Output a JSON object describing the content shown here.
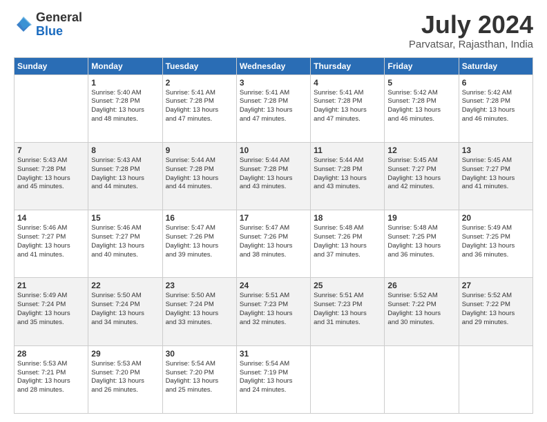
{
  "logo": {
    "general": "General",
    "blue": "Blue"
  },
  "header": {
    "month": "July 2024",
    "location": "Parvatsar, Rajasthan, India"
  },
  "weekdays": [
    "Sunday",
    "Monday",
    "Tuesday",
    "Wednesday",
    "Thursday",
    "Friday",
    "Saturday"
  ],
  "weeks": [
    [
      {
        "day": "",
        "info": ""
      },
      {
        "day": "1",
        "info": "Sunrise: 5:40 AM\nSunset: 7:28 PM\nDaylight: 13 hours\nand 48 minutes."
      },
      {
        "day": "2",
        "info": "Sunrise: 5:41 AM\nSunset: 7:28 PM\nDaylight: 13 hours\nand 47 minutes."
      },
      {
        "day": "3",
        "info": "Sunrise: 5:41 AM\nSunset: 7:28 PM\nDaylight: 13 hours\nand 47 minutes."
      },
      {
        "day": "4",
        "info": "Sunrise: 5:41 AM\nSunset: 7:28 PM\nDaylight: 13 hours\nand 47 minutes."
      },
      {
        "day": "5",
        "info": "Sunrise: 5:42 AM\nSunset: 7:28 PM\nDaylight: 13 hours\nand 46 minutes."
      },
      {
        "day": "6",
        "info": "Sunrise: 5:42 AM\nSunset: 7:28 PM\nDaylight: 13 hours\nand 46 minutes."
      }
    ],
    [
      {
        "day": "7",
        "info": "Sunrise: 5:43 AM\nSunset: 7:28 PM\nDaylight: 13 hours\nand 45 minutes."
      },
      {
        "day": "8",
        "info": "Sunrise: 5:43 AM\nSunset: 7:28 PM\nDaylight: 13 hours\nand 44 minutes."
      },
      {
        "day": "9",
        "info": "Sunrise: 5:44 AM\nSunset: 7:28 PM\nDaylight: 13 hours\nand 44 minutes."
      },
      {
        "day": "10",
        "info": "Sunrise: 5:44 AM\nSunset: 7:28 PM\nDaylight: 13 hours\nand 43 minutes."
      },
      {
        "day": "11",
        "info": "Sunrise: 5:44 AM\nSunset: 7:28 PM\nDaylight: 13 hours\nand 43 minutes."
      },
      {
        "day": "12",
        "info": "Sunrise: 5:45 AM\nSunset: 7:27 PM\nDaylight: 13 hours\nand 42 minutes."
      },
      {
        "day": "13",
        "info": "Sunrise: 5:45 AM\nSunset: 7:27 PM\nDaylight: 13 hours\nand 41 minutes."
      }
    ],
    [
      {
        "day": "14",
        "info": "Sunrise: 5:46 AM\nSunset: 7:27 PM\nDaylight: 13 hours\nand 41 minutes."
      },
      {
        "day": "15",
        "info": "Sunrise: 5:46 AM\nSunset: 7:27 PM\nDaylight: 13 hours\nand 40 minutes."
      },
      {
        "day": "16",
        "info": "Sunrise: 5:47 AM\nSunset: 7:26 PM\nDaylight: 13 hours\nand 39 minutes."
      },
      {
        "day": "17",
        "info": "Sunrise: 5:47 AM\nSunset: 7:26 PM\nDaylight: 13 hours\nand 38 minutes."
      },
      {
        "day": "18",
        "info": "Sunrise: 5:48 AM\nSunset: 7:26 PM\nDaylight: 13 hours\nand 37 minutes."
      },
      {
        "day": "19",
        "info": "Sunrise: 5:48 AM\nSunset: 7:25 PM\nDaylight: 13 hours\nand 36 minutes."
      },
      {
        "day": "20",
        "info": "Sunrise: 5:49 AM\nSunset: 7:25 PM\nDaylight: 13 hours\nand 36 minutes."
      }
    ],
    [
      {
        "day": "21",
        "info": "Sunrise: 5:49 AM\nSunset: 7:24 PM\nDaylight: 13 hours\nand 35 minutes."
      },
      {
        "day": "22",
        "info": "Sunrise: 5:50 AM\nSunset: 7:24 PM\nDaylight: 13 hours\nand 34 minutes."
      },
      {
        "day": "23",
        "info": "Sunrise: 5:50 AM\nSunset: 7:24 PM\nDaylight: 13 hours\nand 33 minutes."
      },
      {
        "day": "24",
        "info": "Sunrise: 5:51 AM\nSunset: 7:23 PM\nDaylight: 13 hours\nand 32 minutes."
      },
      {
        "day": "25",
        "info": "Sunrise: 5:51 AM\nSunset: 7:23 PM\nDaylight: 13 hours\nand 31 minutes."
      },
      {
        "day": "26",
        "info": "Sunrise: 5:52 AM\nSunset: 7:22 PM\nDaylight: 13 hours\nand 30 minutes."
      },
      {
        "day": "27",
        "info": "Sunrise: 5:52 AM\nSunset: 7:22 PM\nDaylight: 13 hours\nand 29 minutes."
      }
    ],
    [
      {
        "day": "28",
        "info": "Sunrise: 5:53 AM\nSunset: 7:21 PM\nDaylight: 13 hours\nand 28 minutes."
      },
      {
        "day": "29",
        "info": "Sunrise: 5:53 AM\nSunset: 7:20 PM\nDaylight: 13 hours\nand 26 minutes."
      },
      {
        "day": "30",
        "info": "Sunrise: 5:54 AM\nSunset: 7:20 PM\nDaylight: 13 hours\nand 25 minutes."
      },
      {
        "day": "31",
        "info": "Sunrise: 5:54 AM\nSunset: 7:19 PM\nDaylight: 13 hours\nand 24 minutes."
      },
      {
        "day": "",
        "info": ""
      },
      {
        "day": "",
        "info": ""
      },
      {
        "day": "",
        "info": ""
      }
    ]
  ]
}
